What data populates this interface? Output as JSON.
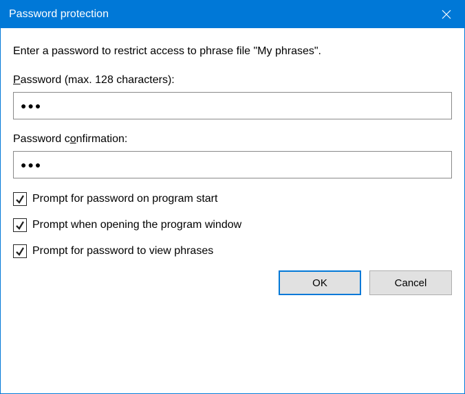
{
  "title": "Password protection",
  "description": "Enter a password to restrict access to phrase file \"My phrases\".",
  "password": {
    "label": "Password (max. 128 characters):",
    "value": "●●●"
  },
  "confirm": {
    "label_pre": "Password c",
    "label_u": "o",
    "label_post": "nfirmation:",
    "value": "●●●"
  },
  "checkboxes": {
    "start": {
      "label": "Prompt for password on program start",
      "checked": true
    },
    "window": {
      "label": "Prompt when opening the program window",
      "checked": true
    },
    "view": {
      "label": "Prompt for password to view phrases",
      "checked": true
    }
  },
  "buttons": {
    "ok": "OK",
    "cancel": "Cancel"
  }
}
